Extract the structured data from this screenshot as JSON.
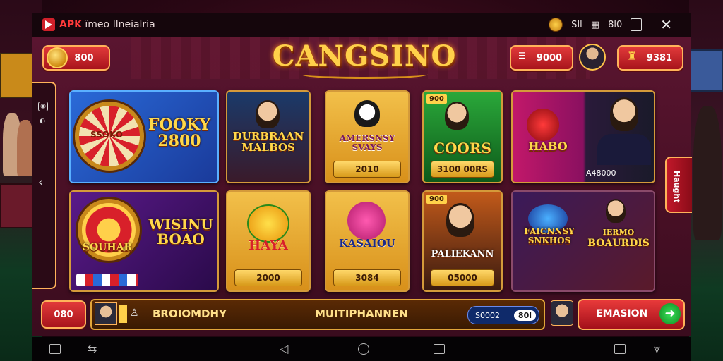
{
  "topbar": {
    "app_title_accent": "APK",
    "app_title": "ïmeo Ilneialria",
    "stat1": "SIl",
    "stat2": "8l0"
  },
  "header": {
    "logo": "CANGSINO",
    "coins": "800",
    "chips": "9000",
    "gems": "9381"
  },
  "games": [
    {
      "title": "FOOKY 2800",
      "wheel_label": "SSOKO",
      "value": ""
    },
    {
      "title": "DURBRAAN MALBOS",
      "value": ""
    },
    {
      "title": "AMERSNSY SVAYS",
      "value": "2010"
    },
    {
      "title": "COORS",
      "tag": "900",
      "value": "3100 00RS"
    },
    {
      "title": "HABO",
      "value": "A48000"
    },
    {
      "title": "WISINU BOAO",
      "sub": "SOUHAR",
      "value": ""
    },
    {
      "title": "HAYA",
      "value": "2000"
    },
    {
      "title": "KASAIOU",
      "value": "3084"
    },
    {
      "title": "PALIEKANN",
      "tag": "900",
      "value": "05000"
    },
    {
      "title": "FAICNNSY SNKHOS",
      "value": ""
    },
    {
      "title": "BOAURDIS",
      "pre": "IERMO",
      "value": ""
    }
  ],
  "side": {
    "right_tab": "Haught"
  },
  "bottom": {
    "left_value": "080",
    "ticker_a": "BROIOMDHY",
    "ticker_b": "MUITIPHANNEN",
    "balance_a": "S0002",
    "balance_b": "80l",
    "action": "EMASION"
  },
  "colors": {
    "accent": "#ffb35a",
    "red": "#c2182a",
    "gold": "#ffd04a"
  }
}
